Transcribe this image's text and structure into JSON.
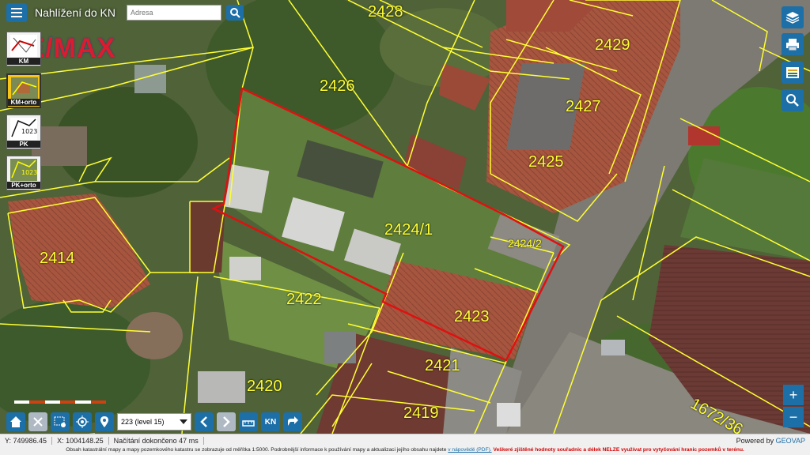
{
  "app": {
    "title": "Nahlížení do KN",
    "search_placeholder": "Adresa"
  },
  "brand": {
    "logo_text": "RE/MAX"
  },
  "layers": [
    {
      "label": "KM",
      "icon": "cadastral-map-icon"
    },
    {
      "label": "KM+orto",
      "icon": "cadastral-orto-icon"
    },
    {
      "label": "PK",
      "icon": "land-register-icon"
    },
    {
      "label": "PK+orto",
      "icon": "land-register-orto-icon"
    }
  ],
  "parcels": [
    "2428",
    "2429",
    "2426",
    "2427",
    "2425",
    "2424/1",
    "2424/2",
    "2414",
    "2422",
    "2423",
    "2421",
    "2420",
    "2419",
    "1672/36"
  ],
  "toolbar": {
    "scale_select": "223 (level 15)",
    "kn_label": "KN"
  },
  "status": {
    "y": "Y: 749986.45",
    "x": "X: 1004148.25",
    "loading": "Načítání dokončeno 47 ms",
    "powered_prefix": "Powered by",
    "powered_brand": "GEOVAP"
  },
  "disclaimer": {
    "text": "Obsah katastrální mapy a mapy pozemkového katastru se zobrazuje od měřítka 1:5000. Podrobnější informace k používání mapy a aktualizaci jejího obsahu najdete",
    "link": "v nápovědě (PDF).",
    "warning": "Veškeré zjištěné hodnoty souřadnic a délek NELZE využívat pro vytyčování hranic pozemků v terénu."
  },
  "zoom": {
    "in": "+",
    "out": "−"
  },
  "colors": {
    "accent": "#1d6fa8",
    "parcel_line": "#ffff33",
    "selection": "#e01010"
  }
}
